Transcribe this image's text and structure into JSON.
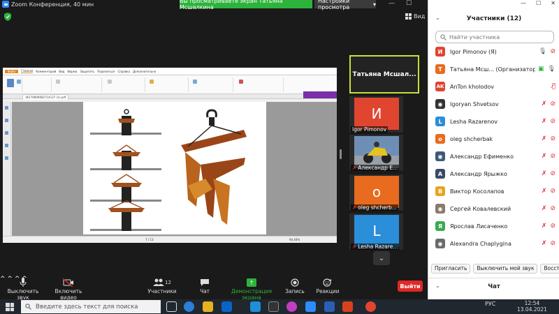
{
  "window": {
    "title": "Zoom Конференция, 40 мин",
    "share_banner": "Вы просматриваете экран Татьяна Мсшалкина",
    "view_options": "Настройки просмотра",
    "view_label": "Вид"
  },
  "shared_screen": {
    "ribbon_tabs": [
      "Файл",
      "Главная",
      "Комментарий",
      "Вид",
      "Форма",
      "Защитить",
      "Поделиться",
      "Справка",
      "Дополнительно"
    ],
    "doc_tab": "3K170809082714127 (1).pdf",
    "page_indicator": "7 / 13",
    "zoom": "94,44%"
  },
  "gallery": {
    "main_tile": "Татьяна Мсшал...",
    "tiles": [
      {
        "name": "Igor Pimonov",
        "initial": "И",
        "color": "#e0452f",
        "muted": false
      },
      {
        "name": "Александр Е...",
        "initial": "",
        "color": "#3d5a7a",
        "muted": true
      },
      {
        "name": "oleg shcherb...",
        "initial": "o",
        "color": "#e86b1f",
        "muted": true
      },
      {
        "name": "Lesha Razare...",
        "initial": "L",
        "color": "#2b8ed8",
        "muted": true
      }
    ]
  },
  "toolbar": {
    "mute": "Выключить звук",
    "video": "Включить видео",
    "participants": "Участники",
    "participants_count": "12",
    "chat": "Чат",
    "share": "Демонстрация экрана",
    "record": "Запись",
    "reactions": "Реакции",
    "leave": "Выйти"
  },
  "panel": {
    "title": "Участники (12)",
    "search_placeholder": "Найти участника",
    "participants": [
      {
        "name": "Igor Pimonov (Я)",
        "initial": "И",
        "color": "#e0452f",
        "video": "off",
        "mic": "on"
      },
      {
        "name": "Татьяна Мсш... (Организатор)",
        "initial": "Т",
        "color": "#e86b1f",
        "video": "share",
        "mic": "on"
      },
      {
        "name": "AnTon kholodov",
        "initial": "AK",
        "color": "#e0452f",
        "video": "none",
        "mic": "off"
      },
      {
        "name": "Igoryan Shvetsov",
        "initial": "",
        "color": "#333333",
        "video": "off",
        "mic": "off"
      },
      {
        "name": "Lesha Razarenov",
        "initial": "L",
        "color": "#2b8ed8",
        "video": "off",
        "mic": "off"
      },
      {
        "name": "oleg shcherbak",
        "initial": "o",
        "color": "#e86b1f",
        "video": "off",
        "mic": "off"
      },
      {
        "name": "Александр Ефименко",
        "initial": "",
        "color": "#3d5a7a",
        "video": "off",
        "mic": "off"
      },
      {
        "name": "Александр Ярыжко",
        "initial": "А",
        "color": "#3a4a66",
        "video": "off",
        "mic": "off"
      },
      {
        "name": "Виктор Косолапов",
        "initial": "В",
        "color": "#e8a31f",
        "video": "off",
        "mic": "off"
      },
      {
        "name": "Сергей Ковалевский",
        "initial": "",
        "color": "#8a7a6a",
        "video": "off",
        "mic": "off"
      },
      {
        "name": "Ярослав Лисаченко",
        "initial": "Я",
        "color": "#3aaa52",
        "video": "off",
        "mic": "off"
      },
      {
        "name": "Alexandra Chaplygina",
        "initial": "",
        "color": "#6a6a6a",
        "video": "off",
        "mic": "off"
      }
    ],
    "invite": "Пригласить",
    "mute_me": "Выключить мой звук",
    "restore": "Восстановить",
    "chat_title": "Чат"
  },
  "taskbar": {
    "search_placeholder": "Введите здесь текст для поиска",
    "lang": "РУС",
    "time": "12:54",
    "date": "13.04.2021"
  }
}
